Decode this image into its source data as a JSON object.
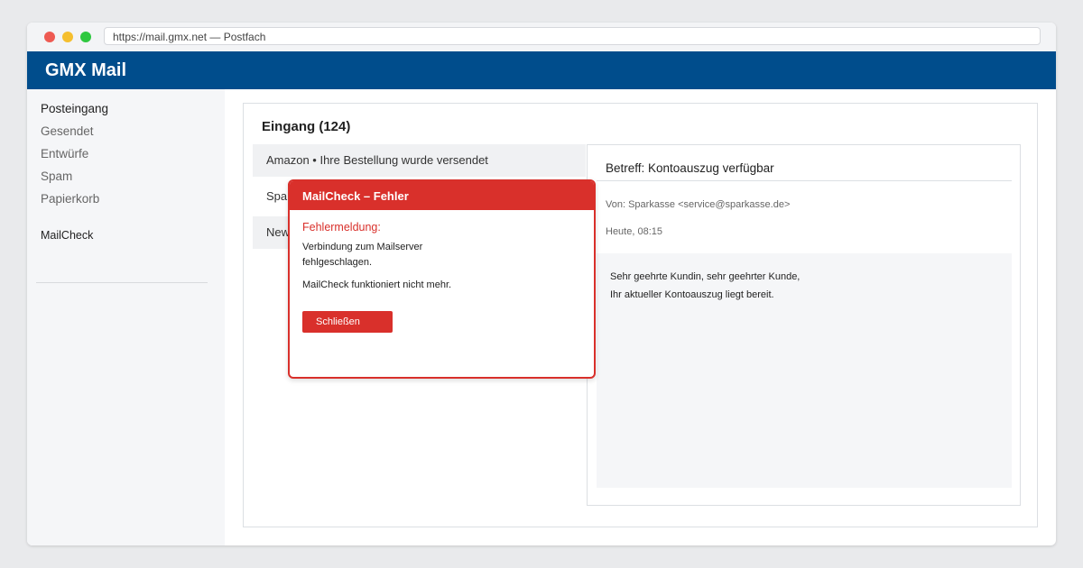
{
  "browser": {
    "url": "https://mail.gmx.net — Postfach"
  },
  "app": {
    "brand": "GMX Mail"
  },
  "sidebar": {
    "items": [
      {
        "label": "Posteingang"
      },
      {
        "label": "Gesendet"
      },
      {
        "label": "Entwürfe"
      },
      {
        "label": "Spam"
      },
      {
        "label": "Papierkorb"
      },
      {
        "label": "MailCheck"
      }
    ]
  },
  "inbox": {
    "title": "Eingang (124)",
    "rows": [
      {
        "text": "Amazon • Ihre Bestellung wurde versendet"
      },
      {
        "text": "Spar"
      },
      {
        "text": "New"
      }
    ]
  },
  "reader": {
    "subject": "Betreff: Kontoauszug verfügbar",
    "from": "Von: Sparkasse <service@sparkasse.de>",
    "date": "Heute, 08:15",
    "body": [
      "Sehr geehrte Kundin, sehr geehrter Kunde,",
      "Ihr aktueller Kontoauszug liegt bereit."
    ]
  },
  "dialog": {
    "title": "MailCheck – Fehler",
    "label": "Fehlermeldung:",
    "message_lines": [
      "Verbindung zum Mailserver",
      "fehlgeschlagen.",
      "MailCheck funktioniert nicht mehr."
    ],
    "button": "Schließen"
  },
  "colors": {
    "accent": "#004d8c",
    "error": "#d9302b"
  }
}
